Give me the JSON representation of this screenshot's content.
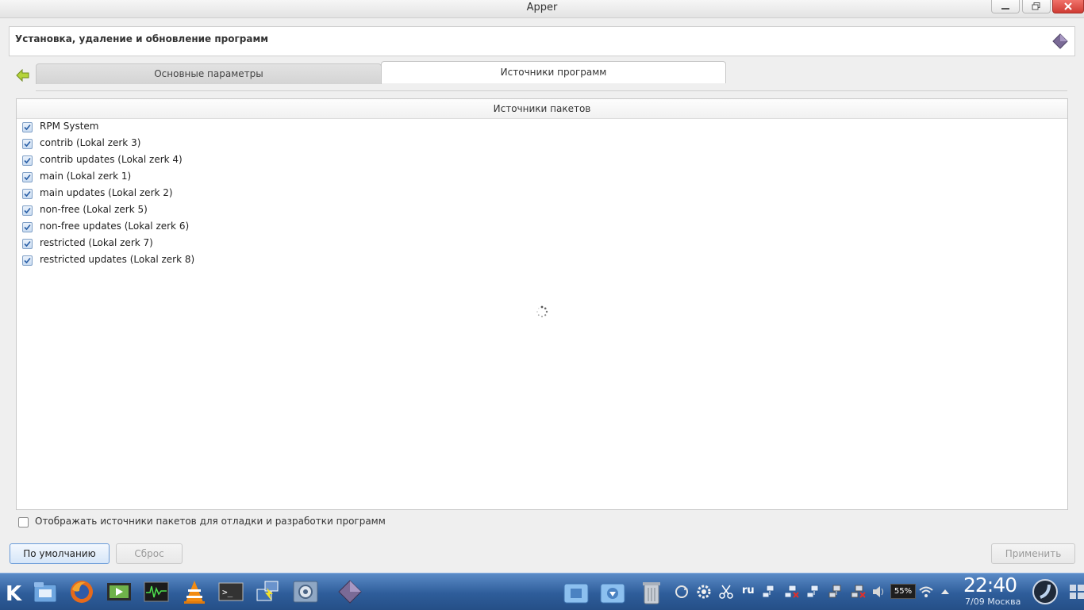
{
  "window": {
    "title": "Apper"
  },
  "header": {
    "title": "Установка, удаление и обновление программ"
  },
  "tabs": [
    {
      "label": "Основные параметры",
      "active": false
    },
    {
      "label": "Источники программ",
      "active": true
    }
  ],
  "sources": {
    "header": "Источники пакетов",
    "items": [
      {
        "label": "RPM System",
        "checked": true
      },
      {
        "label": "contrib (Lokal zerk 3)",
        "checked": true
      },
      {
        "label": "contrib updates (Lokal zerk 4)",
        "checked": true
      },
      {
        "label": "main (Lokal zerk 1)",
        "checked": true
      },
      {
        "label": "main updates (Lokal zerk 2)",
        "checked": true
      },
      {
        "label": "non-free (Lokal zerk 5)",
        "checked": true
      },
      {
        "label": "non-free updates (Lokal zerk 6)",
        "checked": true
      },
      {
        "label": "restricted (Lokal zerk 7)",
        "checked": true
      },
      {
        "label": "restricted updates (Lokal zerk 8)",
        "checked": true
      }
    ],
    "show_debug_label": "Отображать источники пакетов для отладки и разработки программ",
    "show_debug_checked": false
  },
  "buttons": {
    "default_label": "По умолчанию",
    "reset_label": "Сброс",
    "apply_label": "Применить"
  },
  "taskbar": {
    "language": "ru",
    "battery": "55%",
    "time": "22:40",
    "date": "7/09 Москва"
  },
  "colors": {
    "accent": "#4f86c9",
    "taskbar": "#2e5d9a",
    "close_button": "#d9453d"
  }
}
